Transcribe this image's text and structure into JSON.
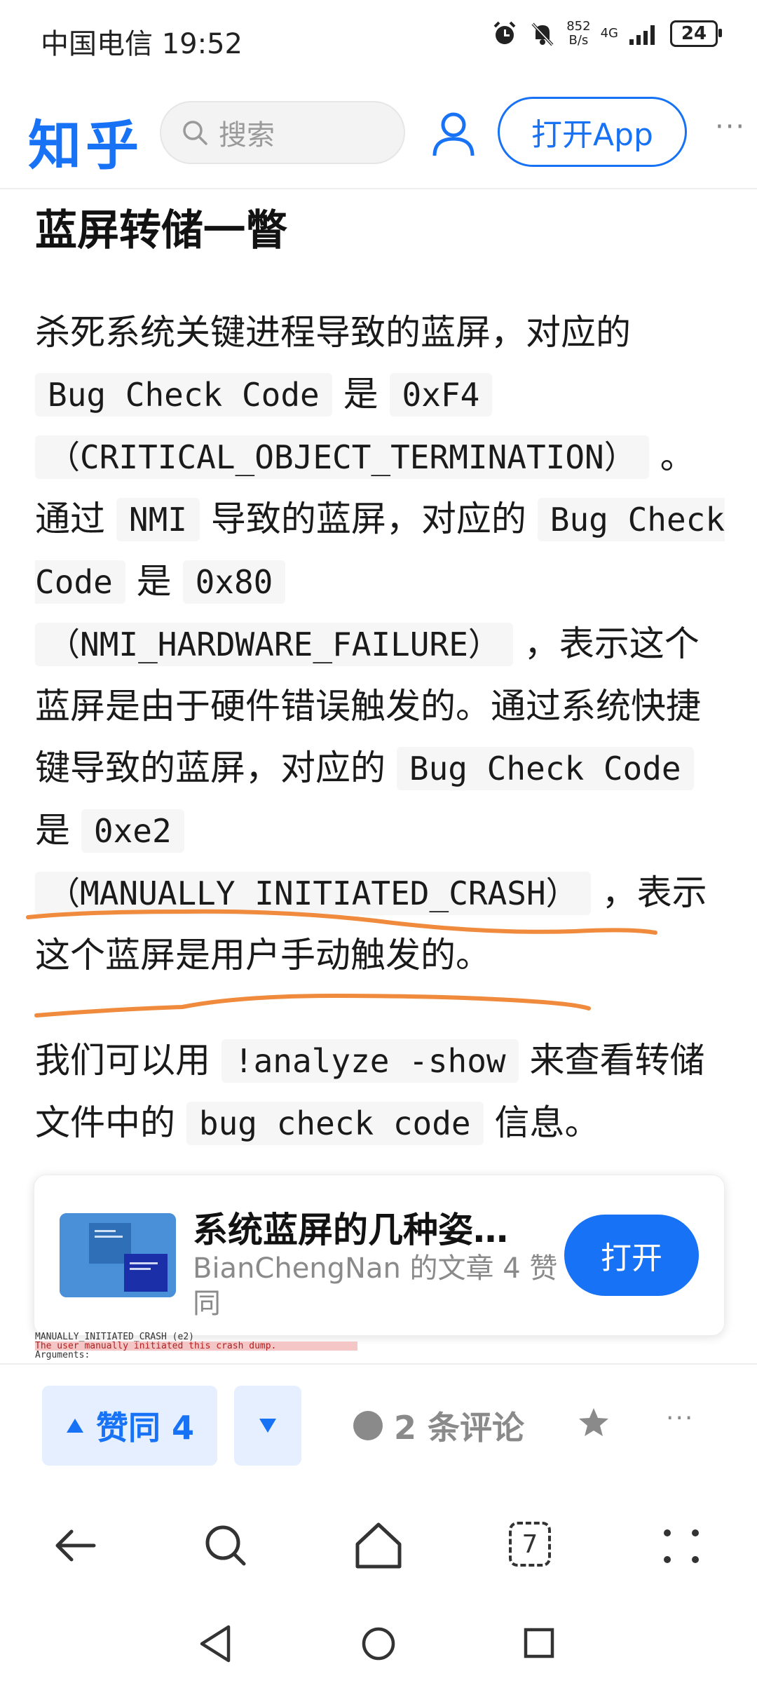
{
  "status_bar": {
    "carrier_time": "中国电信 19:52",
    "net_speed_value": "852",
    "net_speed_unit": "B/s",
    "network": "4G",
    "battery": "24"
  },
  "header": {
    "logo": "知乎",
    "search_placeholder": "搜索",
    "open_app_label": "打开App",
    "more": "···"
  },
  "article": {
    "section_title": "蓝屏转储一瞥",
    "p1": {
      "t1": "杀死系统关键进程导致的蓝屏，对应的",
      "c1": "Bug Check Code",
      "t2": " 是 ",
      "c2": "0xF4",
      "c3": "（CRITICAL_OBJECT_TERMINATION）",
      "t3": " 。通过 ",
      "c4": "NMI",
      "t4": " 导致的蓝屏，对应的 ",
      "c5": "Bug Check Code",
      "t5": " 是 ",
      "c6": "0x80",
      "c7": "（NMI_HARDWARE_FAILURE）",
      "t6": " ，表示这个蓝屏是由于硬件错误触发的。通过系统快捷键导致的蓝屏，对应的 ",
      "c8": "Bug Check Code",
      "t7": " 是 ",
      "c9": "0xe2",
      "c10": "（MANUALLY_INITIATED_CRASH）",
      "t8": " ，表示这个蓝屏是用户手动触发的。"
    },
    "p2": {
      "t1": "我们可以用 ",
      "c1": "!analyze -show",
      "t2": " 来查看转储文件中的 ",
      "c2": "bug check code",
      "t3": " 信息。"
    }
  },
  "card": {
    "title": "系统蓝屏的几种姿…",
    "meta": "BianChengNan 的文章 4 赞同",
    "open_label": "打开"
  },
  "dump_strip": {
    "line1": "MANUALLY_INITIATED_CRASH (e2)",
    "line2": "The user manually initiated this crash dump.",
    "line3": "Arguments:"
  },
  "action_bar": {
    "vote_up_label": "赞同 4",
    "comments_label": "2 条评论",
    "more": "···"
  },
  "browser_bar": {
    "tab_count": "7"
  },
  "colors": {
    "brand": "#1772f6",
    "annotation": "#f08a3c"
  }
}
